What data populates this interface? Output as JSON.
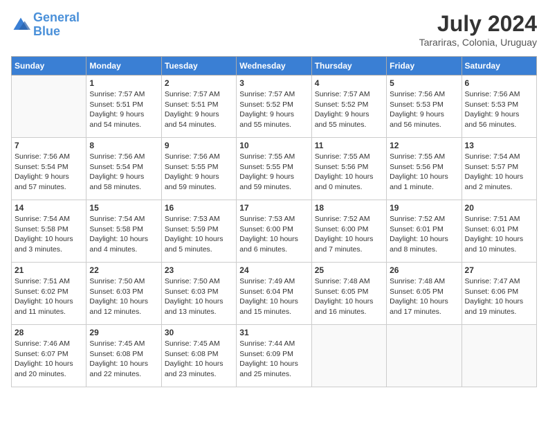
{
  "header": {
    "logo_line1": "General",
    "logo_line2": "Blue",
    "month_title": "July 2024",
    "location": "Tarariras, Colonia, Uruguay"
  },
  "days_of_week": [
    "Sunday",
    "Monday",
    "Tuesday",
    "Wednesday",
    "Thursday",
    "Friday",
    "Saturday"
  ],
  "weeks": [
    [
      {
        "day": "",
        "info": ""
      },
      {
        "day": "1",
        "info": "Sunrise: 7:57 AM\nSunset: 5:51 PM\nDaylight: 9 hours\nand 54 minutes."
      },
      {
        "day": "2",
        "info": "Sunrise: 7:57 AM\nSunset: 5:51 PM\nDaylight: 9 hours\nand 54 minutes."
      },
      {
        "day": "3",
        "info": "Sunrise: 7:57 AM\nSunset: 5:52 PM\nDaylight: 9 hours\nand 55 minutes."
      },
      {
        "day": "4",
        "info": "Sunrise: 7:57 AM\nSunset: 5:52 PM\nDaylight: 9 hours\nand 55 minutes."
      },
      {
        "day": "5",
        "info": "Sunrise: 7:56 AM\nSunset: 5:53 PM\nDaylight: 9 hours\nand 56 minutes."
      },
      {
        "day": "6",
        "info": "Sunrise: 7:56 AM\nSunset: 5:53 PM\nDaylight: 9 hours\nand 56 minutes."
      }
    ],
    [
      {
        "day": "7",
        "info": "Sunrise: 7:56 AM\nSunset: 5:54 PM\nDaylight: 9 hours\nand 57 minutes."
      },
      {
        "day": "8",
        "info": "Sunrise: 7:56 AM\nSunset: 5:54 PM\nDaylight: 9 hours\nand 58 minutes."
      },
      {
        "day": "9",
        "info": "Sunrise: 7:56 AM\nSunset: 5:55 PM\nDaylight: 9 hours\nand 59 minutes."
      },
      {
        "day": "10",
        "info": "Sunrise: 7:55 AM\nSunset: 5:55 PM\nDaylight: 9 hours\nand 59 minutes."
      },
      {
        "day": "11",
        "info": "Sunrise: 7:55 AM\nSunset: 5:56 PM\nDaylight: 10 hours\nand 0 minutes."
      },
      {
        "day": "12",
        "info": "Sunrise: 7:55 AM\nSunset: 5:56 PM\nDaylight: 10 hours\nand 1 minute."
      },
      {
        "day": "13",
        "info": "Sunrise: 7:54 AM\nSunset: 5:57 PM\nDaylight: 10 hours\nand 2 minutes."
      }
    ],
    [
      {
        "day": "14",
        "info": "Sunrise: 7:54 AM\nSunset: 5:58 PM\nDaylight: 10 hours\nand 3 minutes."
      },
      {
        "day": "15",
        "info": "Sunrise: 7:54 AM\nSunset: 5:58 PM\nDaylight: 10 hours\nand 4 minutes."
      },
      {
        "day": "16",
        "info": "Sunrise: 7:53 AM\nSunset: 5:59 PM\nDaylight: 10 hours\nand 5 minutes."
      },
      {
        "day": "17",
        "info": "Sunrise: 7:53 AM\nSunset: 6:00 PM\nDaylight: 10 hours\nand 6 minutes."
      },
      {
        "day": "18",
        "info": "Sunrise: 7:52 AM\nSunset: 6:00 PM\nDaylight: 10 hours\nand 7 minutes."
      },
      {
        "day": "19",
        "info": "Sunrise: 7:52 AM\nSunset: 6:01 PM\nDaylight: 10 hours\nand 8 minutes."
      },
      {
        "day": "20",
        "info": "Sunrise: 7:51 AM\nSunset: 6:01 PM\nDaylight: 10 hours\nand 10 minutes."
      }
    ],
    [
      {
        "day": "21",
        "info": "Sunrise: 7:51 AM\nSunset: 6:02 PM\nDaylight: 10 hours\nand 11 minutes."
      },
      {
        "day": "22",
        "info": "Sunrise: 7:50 AM\nSunset: 6:03 PM\nDaylight: 10 hours\nand 12 minutes."
      },
      {
        "day": "23",
        "info": "Sunrise: 7:50 AM\nSunset: 6:03 PM\nDaylight: 10 hours\nand 13 minutes."
      },
      {
        "day": "24",
        "info": "Sunrise: 7:49 AM\nSunset: 6:04 PM\nDaylight: 10 hours\nand 15 minutes."
      },
      {
        "day": "25",
        "info": "Sunrise: 7:48 AM\nSunset: 6:05 PM\nDaylight: 10 hours\nand 16 minutes."
      },
      {
        "day": "26",
        "info": "Sunrise: 7:48 AM\nSunset: 6:05 PM\nDaylight: 10 hours\nand 17 minutes."
      },
      {
        "day": "27",
        "info": "Sunrise: 7:47 AM\nSunset: 6:06 PM\nDaylight: 10 hours\nand 19 minutes."
      }
    ],
    [
      {
        "day": "28",
        "info": "Sunrise: 7:46 AM\nSunset: 6:07 PM\nDaylight: 10 hours\nand 20 minutes."
      },
      {
        "day": "29",
        "info": "Sunrise: 7:45 AM\nSunset: 6:08 PM\nDaylight: 10 hours\nand 22 minutes."
      },
      {
        "day": "30",
        "info": "Sunrise: 7:45 AM\nSunset: 6:08 PM\nDaylight: 10 hours\nand 23 minutes."
      },
      {
        "day": "31",
        "info": "Sunrise: 7:44 AM\nSunset: 6:09 PM\nDaylight: 10 hours\nand 25 minutes."
      },
      {
        "day": "",
        "info": ""
      },
      {
        "day": "",
        "info": ""
      },
      {
        "day": "",
        "info": ""
      }
    ]
  ]
}
